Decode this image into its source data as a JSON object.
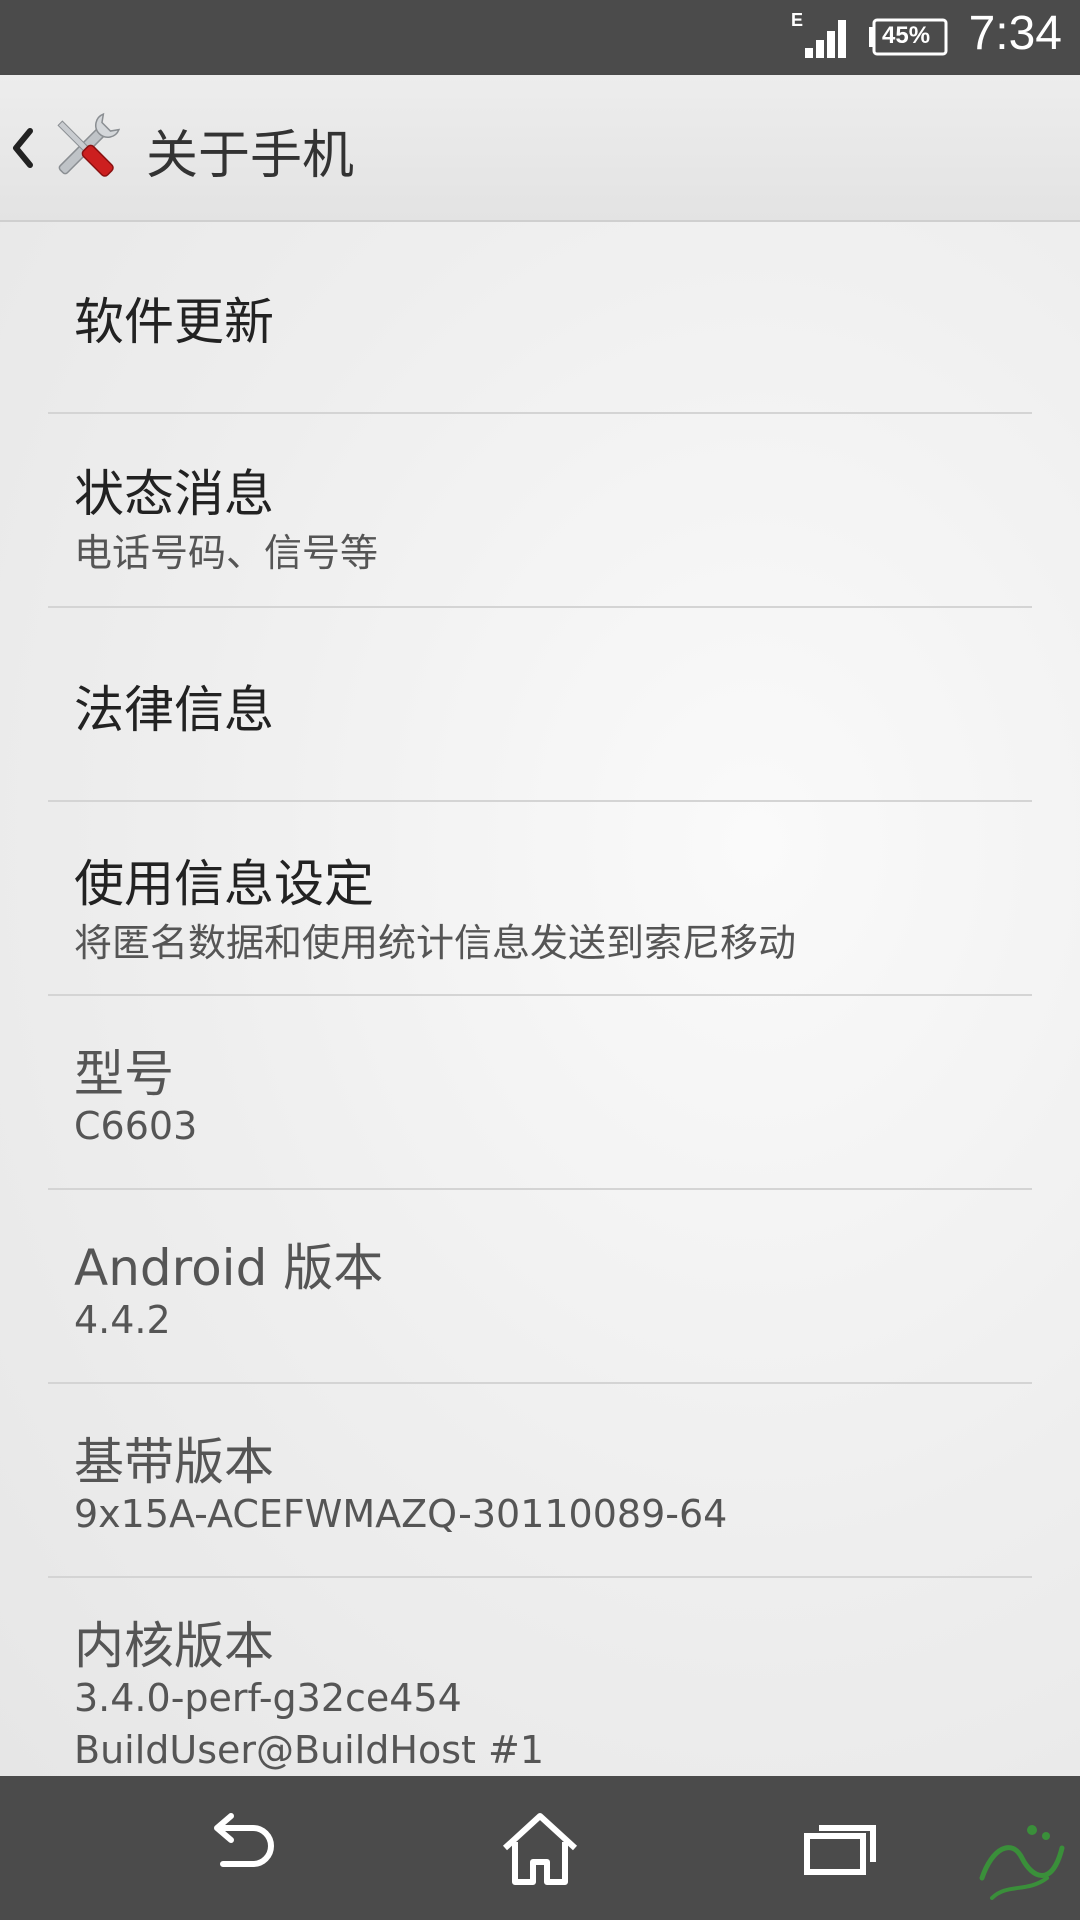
{
  "status_bar": {
    "network_type": "E",
    "battery_percent": "45%",
    "time": "7:34"
  },
  "action_bar": {
    "title": "关于手机",
    "icon": "wrench-screwdriver-icon"
  },
  "items": [
    {
      "title": "软件更新",
      "summary": ""
    },
    {
      "title": "状态消息",
      "summary": "电话号码、信号等"
    },
    {
      "title": "法律信息",
      "summary": ""
    },
    {
      "title": "使用信息设定",
      "summary": "将匿名数据和使用统计信息发送到索尼移动"
    },
    {
      "title": "型号",
      "summary": "C6603"
    },
    {
      "title": "Android 版本",
      "summary": "4.4.2"
    },
    {
      "title": "基带版本",
      "summary": "9x15A-ACEFWMAZQ-30110089-64"
    },
    {
      "title": "内核版本",
      "summary": "3.4.0-perf-g32ce454",
      "summary2": "BuildUser@BuildHost #1"
    }
  ],
  "nav_bar": {
    "back_icon": "back-arrow-icon",
    "home_icon": "home-icon",
    "recents_icon": "recent-apps-icon"
  },
  "colors": {
    "bars": "#4b4b4b",
    "accent_red": "#cc1f1f"
  }
}
